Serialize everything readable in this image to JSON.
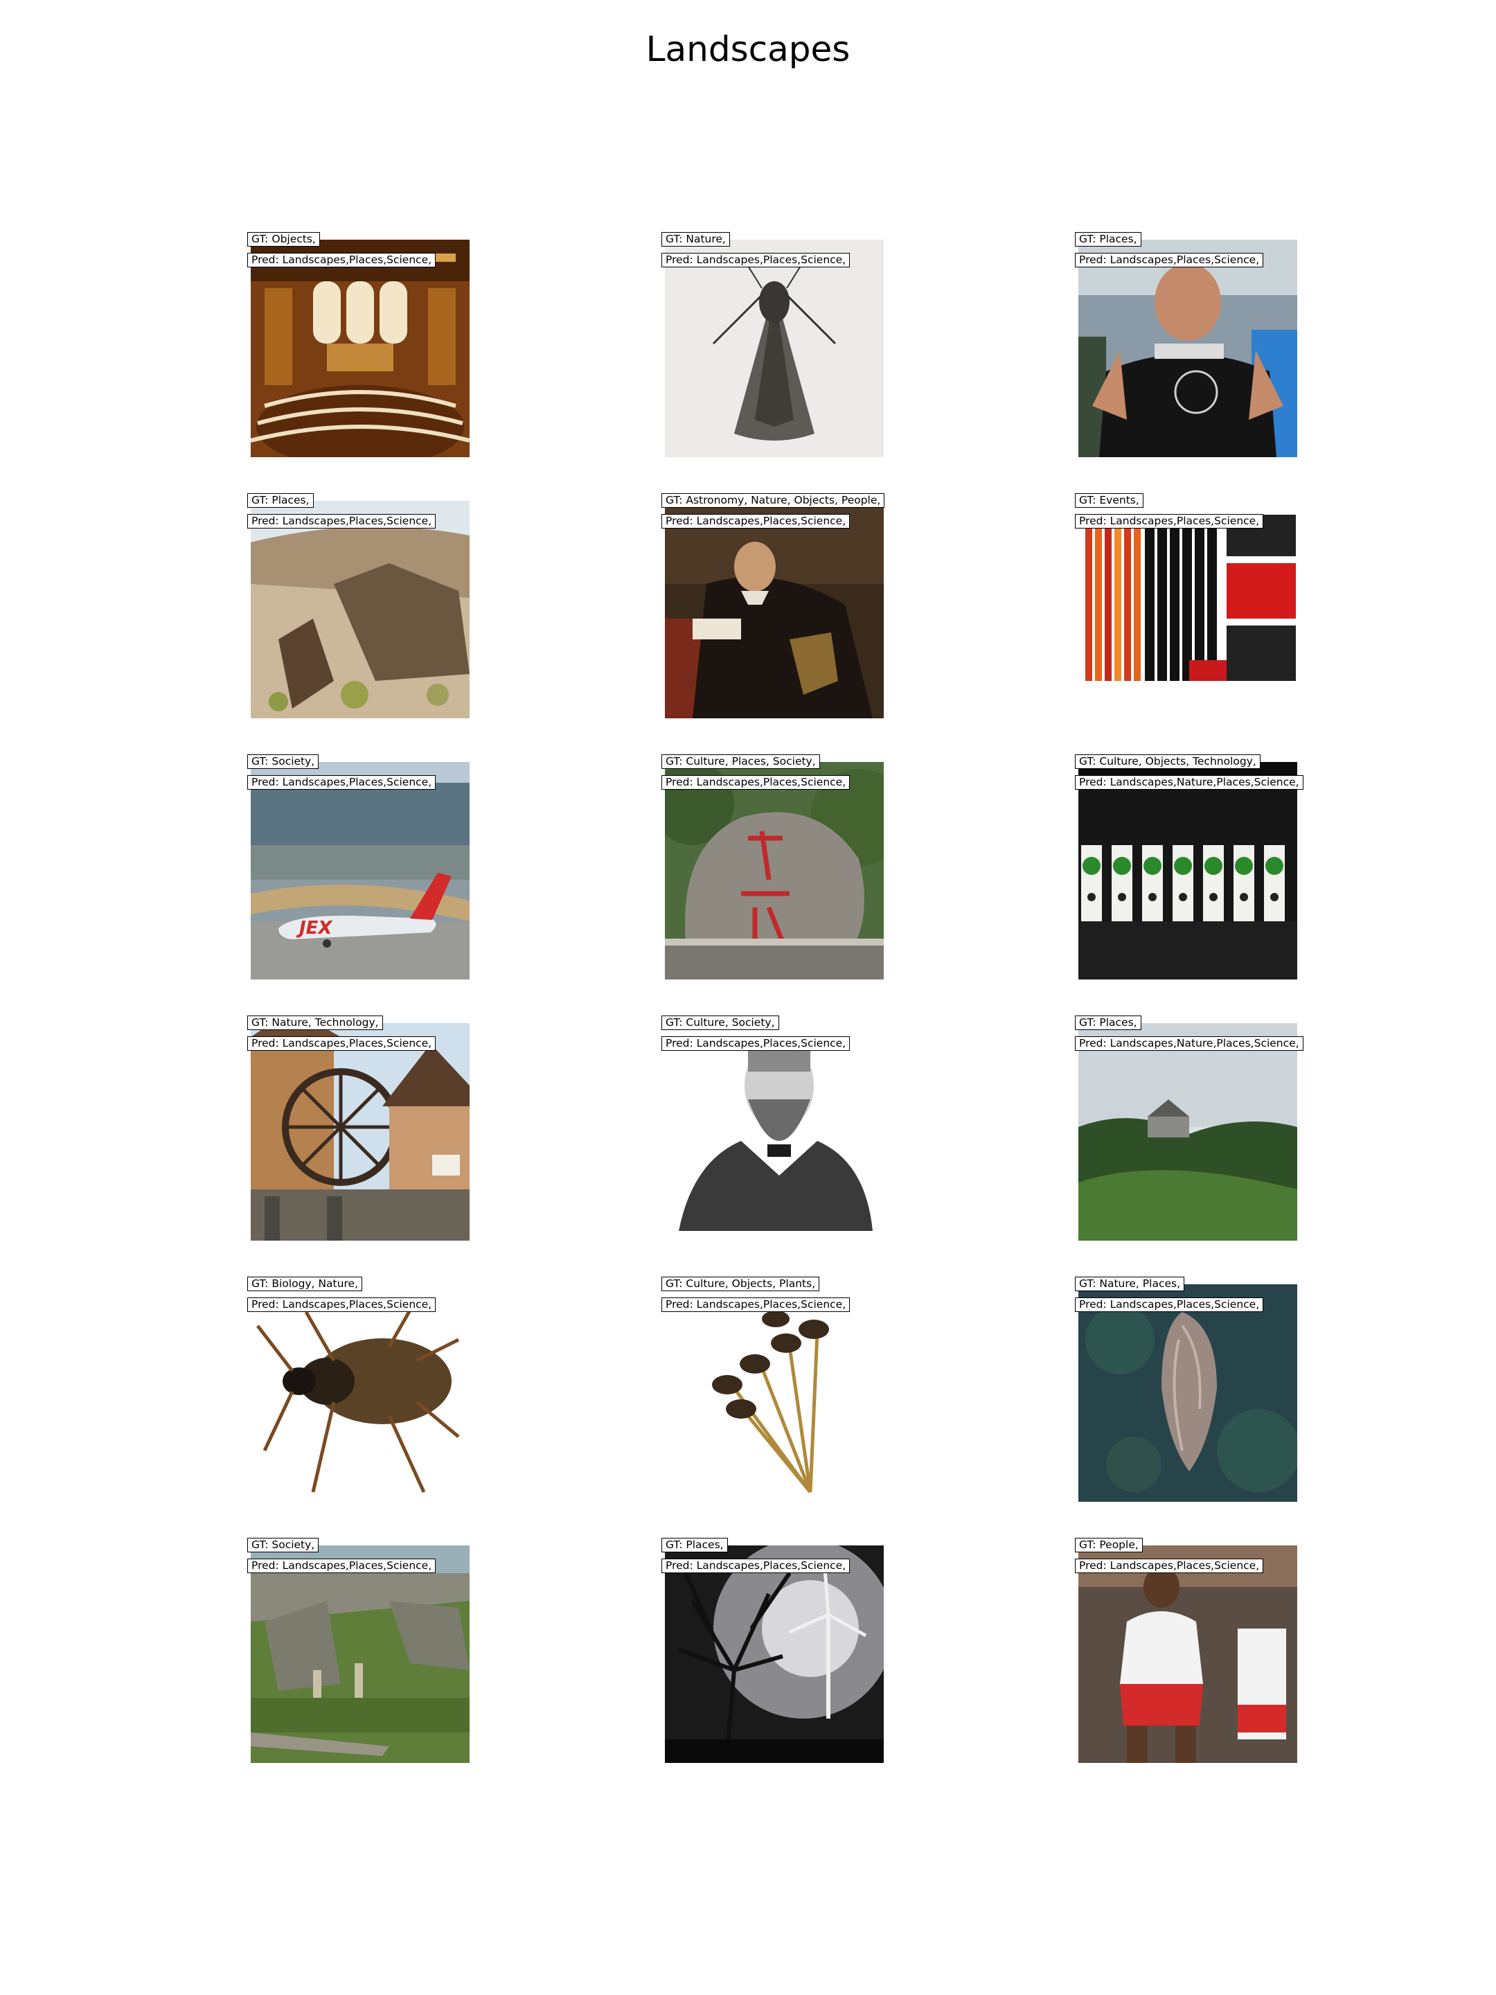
{
  "title": "Landscapes",
  "tiles": [
    {
      "gt": "GT: Objects,",
      "pred": "Pred: Landscapes,Places,Science,",
      "image": "ornate-hall-photo"
    },
    {
      "gt": "GT: Nature,",
      "pred": "Pred: Landscapes,Places,Science,",
      "image": "moth-photo"
    },
    {
      "gt": "GT: Places,",
      "pred": "Pred: Landscapes,Places,Science,",
      "image": "man-in-black-tshirt-photo"
    },
    {
      "gt": "GT: Places,",
      "pred": "Pred: Landscapes,Places,Science,",
      "image": "rocky-desert-photo"
    },
    {
      "gt": "GT: Astronomy, Nature, Objects, People,",
      "pred": "Pred: Landscapes,Places,Science,",
      "image": "portrait-painting"
    },
    {
      "gt": "GT: Events,",
      "pred": "Pred: Landscapes,Places,Science,",
      "image": "event-poster-text"
    },
    {
      "gt": "GT: Society,",
      "pred": "Pred: Landscapes,Places,Science,",
      "image": "jet-airplane-photo"
    },
    {
      "gt": "GT: Culture, Places, Society,",
      "pred": "Pred: Landscapes,Places,Science,",
      "image": "carved-rock-photo"
    },
    {
      "gt": "GT: Culture, Objects, Technology,",
      "pred": "Pred: Landscapes,Nature,Places,Science,",
      "image": "wine-bottles-photo"
    },
    {
      "gt": "GT: Nature, Technology,",
      "pred": "Pred: Landscapes,Places,Science,",
      "image": "water-wheel-photo"
    },
    {
      "gt": "GT: Culture, Society,",
      "pred": "Pred: Landscapes,Places,Science,",
      "image": "engraved-portrait"
    },
    {
      "gt": "GT: Places,",
      "pred": "Pred: Landscapes,Nature,Places,Science,",
      "image": "green-valley-photo"
    },
    {
      "gt": "GT: Biology, Nature,",
      "pred": "Pred: Landscapes,Places,Science,",
      "image": "beetle-photo"
    },
    {
      "gt": "GT: Culture, Objects, Plants,",
      "pred": "Pred: Landscapes,Places,Science,",
      "image": "seed-head-photo"
    },
    {
      "gt": "GT: Nature, Places,",
      "pred": "Pred: Landscapes,Places,Science,",
      "image": "aerial-island-photo"
    },
    {
      "gt": "GT: Society,",
      "pred": "Pred: Landscapes,Places,Science,",
      "image": "stone-ruins-photo"
    },
    {
      "gt": "GT: Places,",
      "pred": "Pred: Landscapes,Places,Science,",
      "image": "wind-turbine-tree-photo"
    },
    {
      "gt": "GT: People,",
      "pred": "Pred: Landscapes,Places,Science,",
      "image": "volleyball-player-photo"
    }
  ]
}
